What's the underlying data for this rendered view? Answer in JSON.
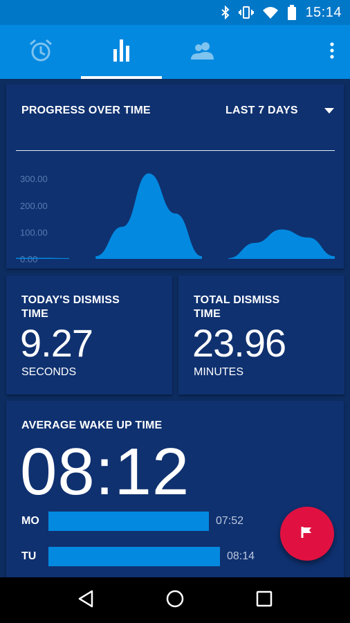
{
  "status_bar": {
    "time": "15:14"
  },
  "tabs": [
    {
      "name": "alarms",
      "icon": "alarm-clock-icon",
      "active": false
    },
    {
      "name": "statistics",
      "icon": "bar-chart-icon",
      "active": true
    },
    {
      "name": "contacts",
      "icon": "people-icon",
      "active": false
    }
  ],
  "progress": {
    "title": "PROGRESS OVER TIME",
    "range_label": "LAST 7 DAYS"
  },
  "chart_data": {
    "type": "area",
    "y_ticks": [
      "300.00",
      "200.00",
      "100.00",
      "0.00"
    ],
    "ylim": [
      0,
      360
    ],
    "series": [
      {
        "values": [
          4,
          4,
          3,
          10,
          120,
          320,
          170,
          10,
          3,
          60,
          110,
          80,
          10
        ]
      }
    ],
    "gaps_at": [
      2.5,
      7.5
    ]
  },
  "today": {
    "label": "TODAY'S DISMISS TIME",
    "value": "9.27",
    "unit": "SECONDS"
  },
  "total": {
    "label": "TOTAL DISMISS TIME",
    "value": "23.96",
    "unit": "MINUTES"
  },
  "average": {
    "label": "AVERAGE WAKE UP TIME",
    "time": "08:12",
    "days": [
      {
        "day": "MO",
        "time": "07:52",
        "fraction": 0.86
      },
      {
        "day": "TU",
        "time": "08:14",
        "fraction": 0.92
      }
    ]
  },
  "colors": {
    "accent": "#0389e0",
    "fab": "#e01140",
    "background": "#0d2c60"
  }
}
